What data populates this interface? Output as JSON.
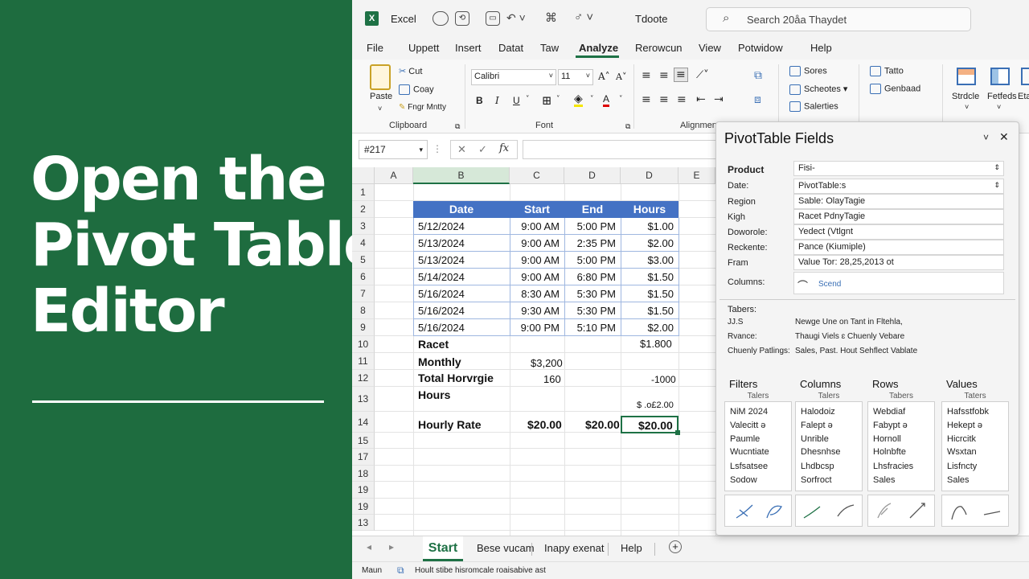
{
  "headline": {
    "lines": [
      "Open the",
      "Pivot Table",
      "Editor"
    ]
  },
  "titlebar": {
    "app": "Excel",
    "doc_title": "Tdoote",
    "search_placeholder": "Search 20åa Thaydet"
  },
  "menu": [
    "File",
    "Uppett",
    "Insert",
    "Datat",
    "Taw",
    "Analyze",
    "Rerowcun",
    "View",
    "Potwidow",
    "Help"
  ],
  "ribbon": {
    "paste": "Paste",
    "cut": "Cut",
    "copy": "Coay",
    "format_painter": "Fngr Mntty",
    "clipboard_label": "Clipboard",
    "font_name": "Calibri",
    "font_size": "11",
    "font_label": "Font",
    "alignment_label": "Alignment",
    "sort_items": [
      "Sores",
      "Scheotes",
      "Salerties"
    ],
    "data_items": [
      "Tatto",
      "Genbaad"
    ],
    "right_buttons": [
      "Strdcle",
      "Fetfeds",
      "Eta Tet"
    ]
  },
  "name_box": "#217",
  "columns": [
    "A",
    "B",
    "C",
    "D",
    "D",
    "E"
  ],
  "rows": [
    "1",
    "2",
    "3",
    "4",
    "5",
    "6",
    "7",
    "8",
    "9",
    "10",
    "11",
    "12",
    "13",
    "14",
    "15",
    "17",
    "18",
    "19",
    "19",
    "13"
  ],
  "table": {
    "headers": [
      "Date",
      "Start",
      "End",
      "Hours"
    ],
    "data": [
      [
        "5/12/2024",
        "9:00 AM",
        "5:00 PM",
        "$1.00"
      ],
      [
        "5/13/2024",
        "9:00 AM",
        "2:35 PM",
        "$2.00"
      ],
      [
        "5/13/2024",
        "9:00 AM",
        "5:00 PM",
        "$3.00"
      ],
      [
        "5/14/2024",
        "9:00 AM",
        "6:80 PM",
        "$1.50"
      ],
      [
        "5/16/2024",
        "8:30 AM",
        "5:30 PM",
        "$1.50"
      ],
      [
        "5/16/2024",
        "9:30 AM",
        "5:30 PM",
        "$1.50"
      ],
      [
        "5/16/2024",
        "9:00 PM",
        "5:10 PM",
        "$2.00"
      ]
    ],
    "r10": {
      "label": "Racet",
      "value": "$1.800"
    },
    "r11": {
      "label": "Monthly",
      "value": "$3,200"
    },
    "r12": {
      "label": "Total Horvrgie",
      "c": "160",
      "e": "-1000"
    },
    "r13": {
      "label": "Hours",
      "e": "$ .o£2.00"
    },
    "r14": {
      "label": "Hourly Rate",
      "c": "$20.00",
      "d": "$20.00",
      "e": "$20.00"
    }
  },
  "sheet_tabs": [
    "Start",
    "Bese vucam",
    "Inapy exenat",
    "Help"
  ],
  "status": {
    "mode": "Maun",
    "text": "Hoult  stibe hisromcale roaisabive ast"
  },
  "pivot": {
    "title": "PivotTable Fields",
    "fields": [
      {
        "label": "Product",
        "value": "Fisi-"
      },
      {
        "label": "Date:",
        "value": "PivotTable:s"
      },
      {
        "label": "Region",
        "value": "Sable: OlayTagie"
      },
      {
        "label": "Kigh",
        "value": "Racet PdnyTagie"
      },
      {
        "label": "Doworole:",
        "value": "Yedect (Vtlgnt"
      },
      {
        "label": "Reckente:",
        "value": "Pance (Kiumiple)"
      },
      {
        "label": "Fram",
        "value": "Value Tor: 28,25,2013 ot"
      }
    ],
    "columns_label": "Columns:",
    "columns_value": "Scend",
    "tabers_label": "Tabers:",
    "notes": [
      {
        "k": "JJ.S",
        "v": "Newge Une on Tant in Fltehla,"
      },
      {
        "k": "Rvance:",
        "v": "Thaugi Viels ɛ Chuenly Vebare"
      },
      {
        "k": "Chuenly Patlings:",
        "v": "Sales, Past. Hout Sehflect Vablate"
      }
    ],
    "quadrants": [
      {
        "title": "Filters",
        "sub": "Talers",
        "items": [
          "NiM 2024",
          "Valecitt ə",
          "Paumle",
          "Wucntiate",
          "Lsfsatsee",
          "Sodow"
        ]
      },
      {
        "title": "Columns",
        "sub": "Talers",
        "items": [
          "Halodoiz",
          "Falept ə",
          "Unrible",
          "Dhesnhse",
          "Lhdbcsp",
          "Sorfroct"
        ]
      },
      {
        "title": "Rows",
        "sub": "Tabers",
        "items": [
          "Webdiaf",
          "Fabypt ə",
          "Hornoll",
          "Holnbfte",
          "Lhsfracies",
          "Sales"
        ]
      },
      {
        "title": "Values",
        "sub": "Taters",
        "items": [
          "Hafsstfobk",
          "Hekept ə",
          "Hicrcitk",
          "Wsxtan",
          "Lisfncty",
          "Sales"
        ]
      }
    ]
  },
  "colors": {
    "brand_green": "#1e7145",
    "header_blue": "#4472c4",
    "panel_green": "#1e6c3f"
  }
}
